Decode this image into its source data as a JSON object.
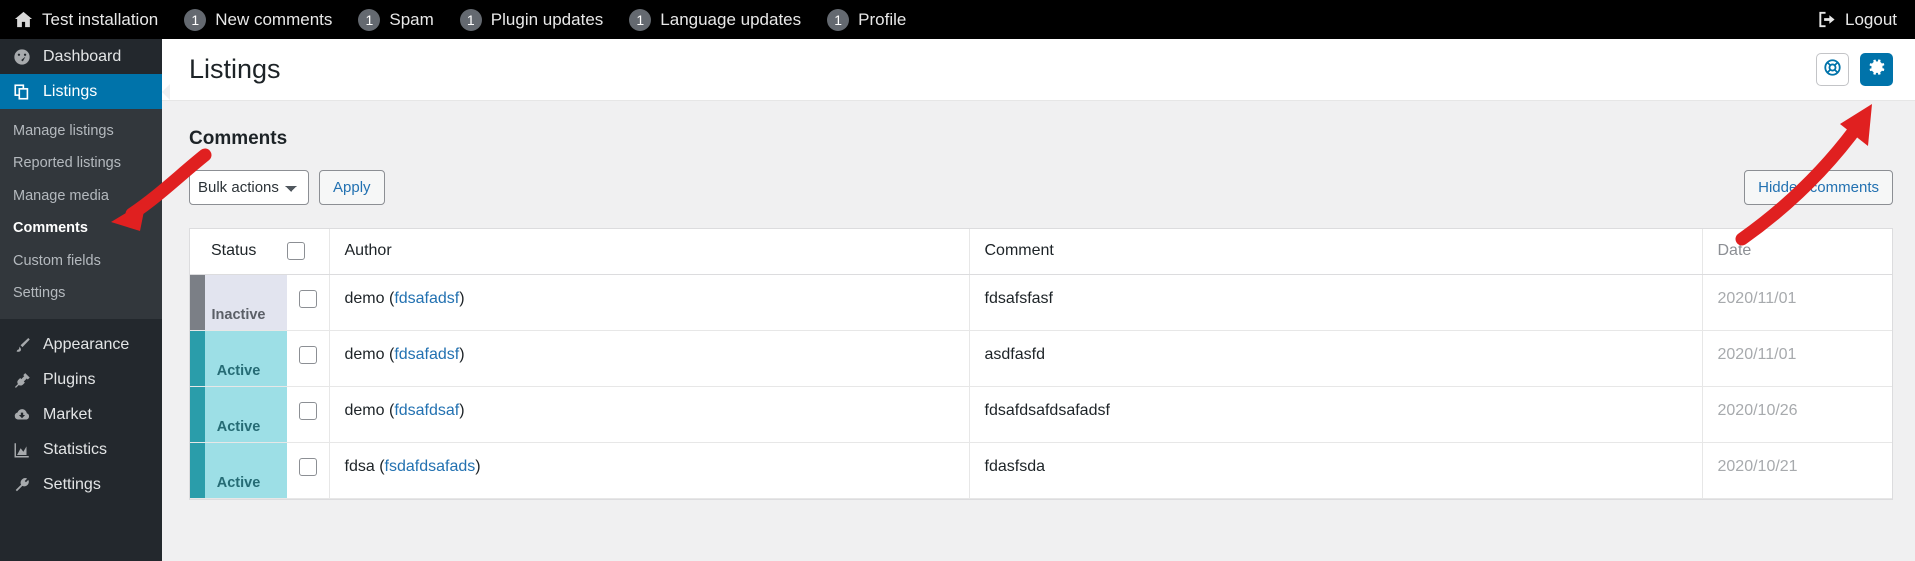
{
  "adminbar": {
    "site_icon": "home-icon",
    "site_name": "Test installation",
    "items": [
      {
        "count": "1",
        "label": "New comments"
      },
      {
        "count": "1",
        "label": "Spam"
      },
      {
        "count": "1",
        "label": "Plugin updates"
      },
      {
        "count": "1",
        "label": "Language updates"
      },
      {
        "count": "1",
        "label": "Profile"
      }
    ],
    "logout_label": "Logout",
    "logout_icon": "sign-out-icon"
  },
  "sidebar": {
    "items": [
      {
        "label": "Dashboard",
        "icon": "dashboard-icon",
        "active": false
      },
      {
        "label": "Listings",
        "icon": "listings-icon",
        "active": true
      }
    ],
    "submenu": [
      {
        "label": "Manage listings",
        "current": false
      },
      {
        "label": "Reported listings",
        "current": false
      },
      {
        "label": "Manage media",
        "current": false
      },
      {
        "label": "Comments",
        "current": true
      },
      {
        "label": "Custom fields",
        "current": false
      },
      {
        "label": "Settings",
        "current": false
      }
    ],
    "items_lower": [
      {
        "label": "Appearance",
        "icon": "brush-icon"
      },
      {
        "label": "Plugins",
        "icon": "plug-icon"
      },
      {
        "label": "Market",
        "icon": "cloud-download-icon"
      },
      {
        "label": "Statistics",
        "icon": "chart-icon"
      },
      {
        "label": "Settings",
        "icon": "wrench-icon"
      }
    ]
  },
  "header": {
    "title": "Listings",
    "help_button_icon": "lifebuoy-icon",
    "settings_button_icon": "gear-icon"
  },
  "main": {
    "section_title": "Comments",
    "bulk_actions_value": "Bulk actions",
    "bulk_actions_options": [
      "Bulk actions"
    ],
    "apply_label": "Apply",
    "hidden_comments_label": "Hidden comments"
  },
  "table": {
    "columns": [
      "Status",
      "",
      "Author",
      "Comment",
      "Date"
    ],
    "rows": [
      {
        "status": "Inactive",
        "author_name": "demo",
        "author_login": "fdsafadsf",
        "comment": "fdsafsfasf",
        "date": "2020/11/01"
      },
      {
        "status": "Active",
        "author_name": "demo",
        "author_login": "fdsafadsf",
        "comment": "asdfasfd",
        "date": "2020/11/01"
      },
      {
        "status": "Active",
        "author_name": "demo",
        "author_login": "fdsafdsaf",
        "comment": "fdsafdsafdsafadsf",
        "date": "2020/10/26"
      },
      {
        "status": "Active",
        "author_name": "fdsa",
        "author_login": "fsdafdsafads",
        "comment": "fdasfsda",
        "date": "2020/10/21"
      }
    ]
  },
  "colors": {
    "accent_blue": "#0073aa",
    "link_blue": "#2271b1",
    "adminbar_bg": "#000000",
    "sidebar_bg": "#23282d",
    "submenu_bg": "#32373c",
    "status_active_bg": "#9ddfe6",
    "status_active_bar": "#2a9daa",
    "status_inactive_bg": "#e2e4ef",
    "status_inactive_bar": "#7b7f86",
    "annotation_red": "#e02020"
  },
  "annotations": [
    {
      "name": "arrow-to-comments",
      "target": "Comments"
    },
    {
      "name": "arrow-to-settings",
      "target": "gear-button"
    }
  ]
}
